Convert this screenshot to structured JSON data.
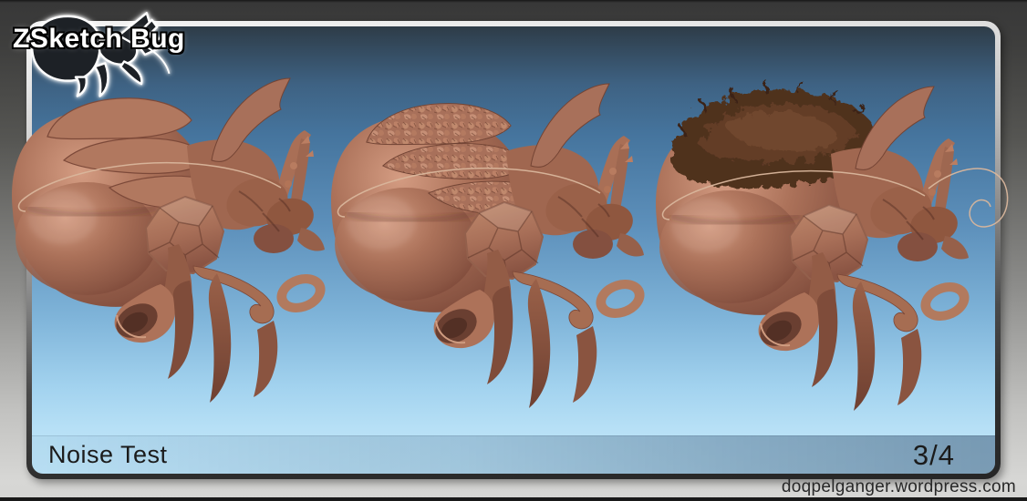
{
  "logo": {
    "title": "ZSketch Bug",
    "icon": "bug-silhouette-icon"
  },
  "panel": {
    "caption": "Noise Test",
    "page_indicator": "3/4"
  },
  "footer": {
    "site_url": "doqpelganger.wordpress.com"
  },
  "figures": [
    {
      "id": "bug-render-1",
      "variant": "smooth-clay-sculpt"
    },
    {
      "id": "bug-render-2",
      "variant": "surface-noise-texture"
    },
    {
      "id": "bug-render-3",
      "variant": "fur-fiber-noise"
    }
  ],
  "colors": {
    "outer_bg_top": "#383838",
    "outer_bg_bottom": "#d5d5d3",
    "frame_light": "#f2f2f2",
    "frame_dark": "#262626",
    "panel_blue_top": "#2e3c48",
    "panel_blue_mid": "#5c8fba",
    "panel_blue_bottom": "#bfe6fa",
    "caption_bar_blue": "#7095b5",
    "clay": "#a86f58",
    "clay_highlight": "#d49c82",
    "clay_shadow": "#7b4637",
    "fur_brown": "#4f2f1f",
    "text_dark": "#1b1b1b",
    "title_fill": "#ffffff",
    "title_outline": "#000000"
  }
}
